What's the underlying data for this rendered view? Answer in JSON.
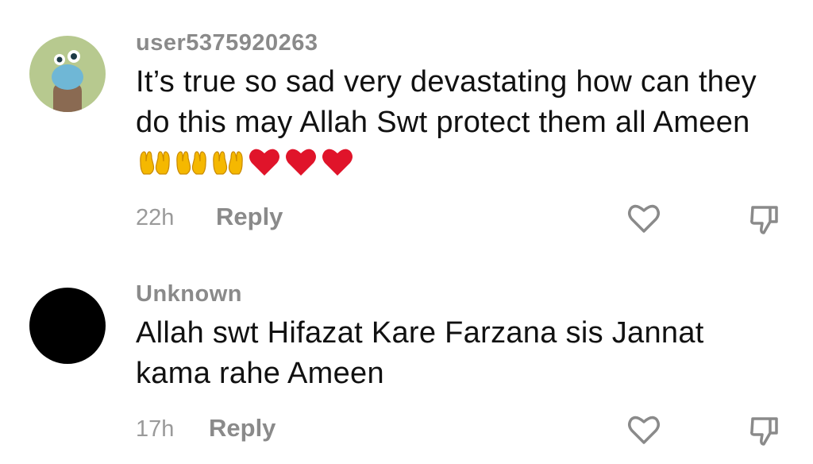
{
  "comments": [
    {
      "username": "user5375920263",
      "text": "It’s true so sad very devastating how can they do this may Allah Swt protect them all Ameen",
      "emojis": [
        "palms-up-together-icon",
        "palms-up-together-icon",
        "palms-up-together-icon",
        "red-heart-icon",
        "red-heart-icon",
        "red-heart-icon"
      ],
      "time": "22h",
      "reply_label": "Reply"
    },
    {
      "username": "Unknown",
      "text": "Allah swt Hifazat Kare Farzana sis Jannat kama rahe Ameen",
      "time": "17h",
      "reply_label": "Reply"
    }
  ],
  "colors": {
    "username": "#8a8a8a",
    "text": "#111111",
    "meta": "#9a9a9a",
    "heart_emoji": "#e0142a",
    "palms_emoji": "#f5b800"
  }
}
